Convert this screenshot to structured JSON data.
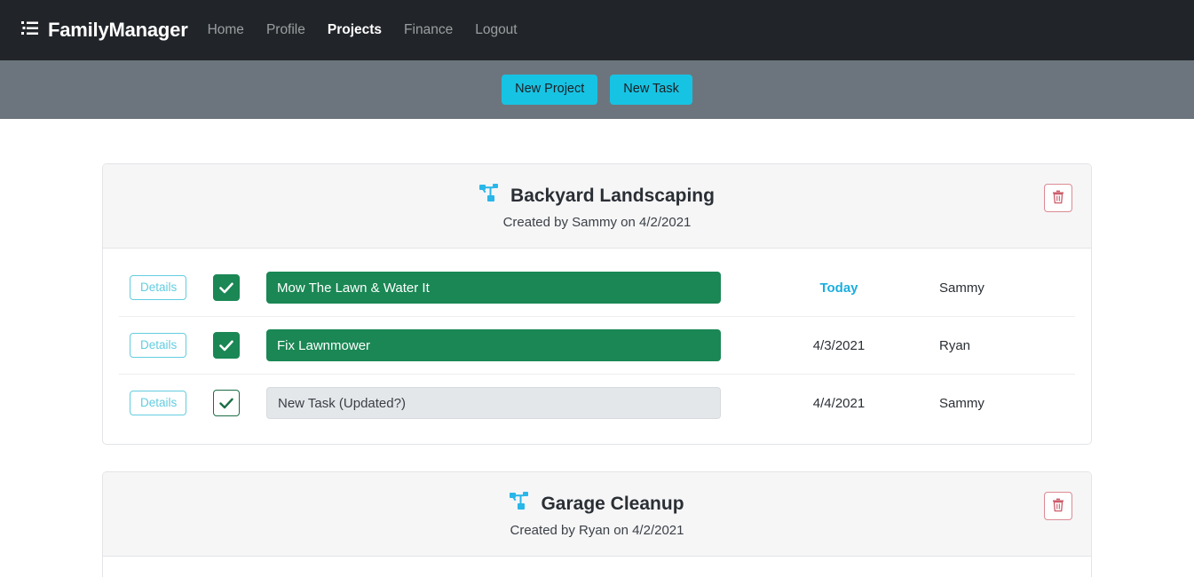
{
  "navbar": {
    "brand": "FamilyManager",
    "brand_icon": "list-tasks-icon",
    "links": [
      {
        "label": "Home",
        "active": false
      },
      {
        "label": "Profile",
        "active": false
      },
      {
        "label": "Projects",
        "active": true
      },
      {
        "label": "Finance",
        "active": false
      },
      {
        "label": "Logout",
        "active": false
      }
    ]
  },
  "action_bar": {
    "background": "#6c757d",
    "buttons": [
      {
        "label": "New Project",
        "color": "#17c3e3"
      },
      {
        "label": "New Task",
        "color": "#17c3e3"
      }
    ]
  },
  "colors": {
    "navbar_bg": "#212529",
    "accent_cyan": "#17c3e3",
    "task_done_green": "#1a8754",
    "task_open_gray": "#e4e7ea",
    "delete_red": "#cd5c6a",
    "today_blue": "#1aaee0"
  },
  "projects": [
    {
      "title": "Backyard Landscaping",
      "icon": "project-diagram-icon",
      "meta": "Created by Sammy on 4/2/2021",
      "delete_icon": "trash-icon",
      "details_label": "Details",
      "tasks": [
        {
          "name": "Mow The Lawn & Water It",
          "status": "done",
          "checked": true,
          "date": "Today",
          "date_is_today": true,
          "owner": "Sammy"
        },
        {
          "name": "Fix Lawnmower",
          "status": "done",
          "checked": true,
          "date": "4/3/2021",
          "date_is_today": false,
          "owner": "Ryan"
        },
        {
          "name": "New Task (Updated?)",
          "status": "open",
          "checked": true,
          "date": "4/4/2021",
          "date_is_today": false,
          "owner": "Sammy"
        }
      ]
    },
    {
      "title": "Garage Cleanup",
      "icon": "project-diagram-icon",
      "meta": "Created by Ryan on 4/2/2021",
      "delete_icon": "trash-icon",
      "details_label": "Details",
      "tasks": []
    }
  ]
}
